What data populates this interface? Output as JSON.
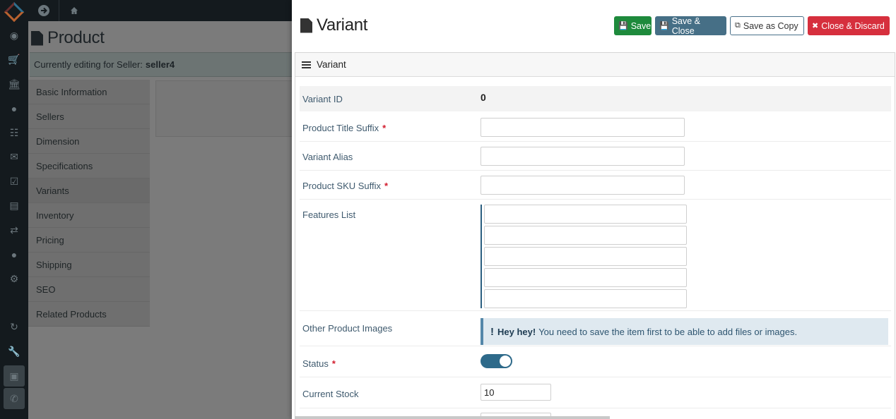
{
  "background": {
    "page_title": "Product",
    "seller_bar": {
      "prefix": "Currently editing for Seller:",
      "seller": "seller4"
    },
    "tabs": [
      {
        "label": "Basic Information"
      },
      {
        "label": "Sellers"
      },
      {
        "label": "Dimension"
      },
      {
        "label": "Specifications"
      },
      {
        "label": "Variants",
        "active": true
      },
      {
        "label": "Inventory"
      },
      {
        "label": "Pricing"
      },
      {
        "label": "Shipping"
      },
      {
        "label": "SEO"
      },
      {
        "label": "Related Products"
      }
    ],
    "rail_icons": [
      "dashboard-icon",
      "cart-icon",
      "bank-icon",
      "user-icon",
      "sitemap-icon",
      "envelope-icon",
      "check-square-icon",
      "chart-icon",
      "exchange-icon",
      "globe-icon",
      "gear-icon"
    ],
    "rail_bottom_icons": [
      "refresh-icon",
      "wrench-icon",
      "book-icon",
      "phone-icon"
    ],
    "top_icons": [
      "arrow-circle-icon",
      "home-icon"
    ]
  },
  "modal": {
    "title": "Variant",
    "buttons": {
      "save": "Save",
      "save_close": "Save & Close",
      "save_copy": "Save as Copy",
      "close_discard": "Close & Discard"
    },
    "card_title": "Variant",
    "fields": {
      "variant_id": {
        "label": "Variant ID",
        "value": "0"
      },
      "title_suffix": {
        "label": "Product Title Suffix",
        "value": ""
      },
      "variant_alias": {
        "label": "Variant Alias",
        "value": ""
      },
      "sku_suffix": {
        "label": "Product SKU Suffix",
        "value": ""
      },
      "features": {
        "label": "Features List",
        "items": [
          "",
          "",
          "",
          "",
          ""
        ]
      },
      "other_images": {
        "label": "Other Product Images",
        "alert_bang": "!",
        "alert_strong": "Hey hey!",
        "alert_text": "You need to save the item first to be able to add files or images."
      },
      "status": {
        "label": "Status",
        "enabled": true
      },
      "current_stock": {
        "label": "Current Stock",
        "value": "10"
      }
    },
    "required_mark": "*"
  },
  "colors": {
    "save": "#1e8a3c",
    "save_close": "#466f86",
    "discard": "#d62f3d",
    "label": "#3f5a6e",
    "required": "#d21d2e",
    "toggle": "#2e6a8a"
  }
}
